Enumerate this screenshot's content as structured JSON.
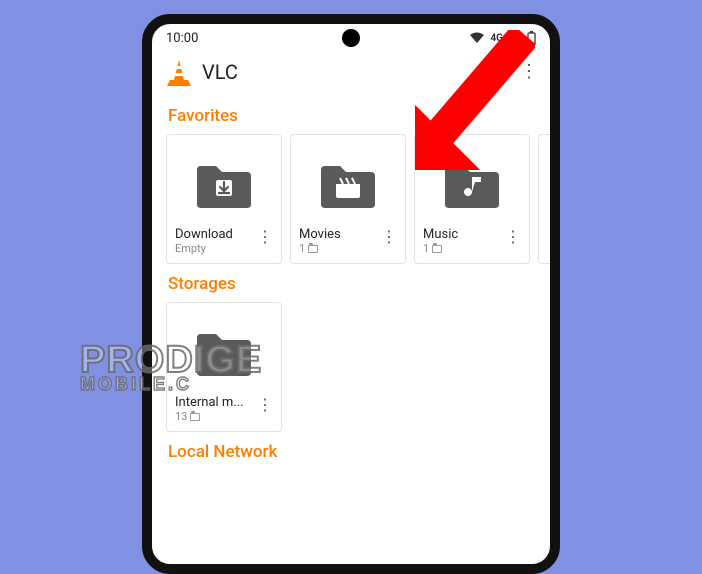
{
  "statusbar": {
    "time": "10:00",
    "network": "4G"
  },
  "appbar": {
    "title": "VLC"
  },
  "sections": {
    "favorites": {
      "title": "Favorites"
    },
    "storages": {
      "title": "Storages"
    },
    "local_network": {
      "title": "Local Network"
    }
  },
  "favorites": [
    {
      "title": "Download",
      "sub": "Empty",
      "icon": "download"
    },
    {
      "title": "Movies",
      "sub": "1",
      "icon": "movies"
    },
    {
      "title": "Music",
      "sub": "1",
      "icon": "music"
    }
  ],
  "storages": [
    {
      "title": "Internal m...",
      "sub": "13",
      "icon": "plain"
    }
  ],
  "watermark": {
    "line1": "PRODIGE",
    "line2": "MOBILE.C"
  },
  "colors": {
    "accent": "#ff7d00",
    "folder": "#5a5a5a"
  }
}
